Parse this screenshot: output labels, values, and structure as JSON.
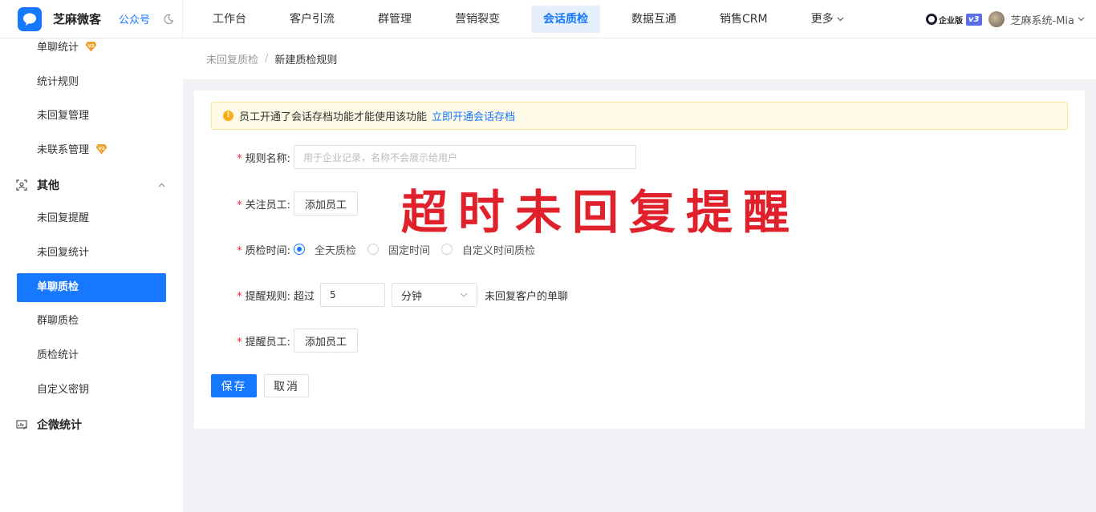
{
  "brand": {
    "name": "芝麻微客",
    "gzh": "公众号"
  },
  "nav": [
    "工作台",
    "客户引流",
    "群管理",
    "营销裂变",
    "会话质检",
    "数据互通",
    "销售CRM"
  ],
  "nav_active": "会话质检",
  "nav_more": "更多",
  "account": {
    "edition": "企业版",
    "version": "v3",
    "username": "芝麻系统-Mia"
  },
  "sidebar": {
    "item_1": "单聊统计",
    "item_2": "统计规则",
    "item_3": "未回复管理",
    "item_4": "未联系管理",
    "group_other": "其他",
    "item_5": "未回复提醒",
    "item_6": "未回复统计",
    "item_7": "单聊质检",
    "item_8": "群聊质检",
    "item_9": "质检统计",
    "item_10": "自定义密钥",
    "group_stats": "企微统计"
  },
  "breadcrumb": {
    "parent": "未回复质检",
    "sep": "/",
    "current": "新建质检规则"
  },
  "alert": {
    "text": "员工开通了会话存档功能才能使用该功能",
    "link": "立即开通会话存档"
  },
  "form": {
    "rule_name_label": "规则名称:",
    "rule_name_placeholder": "用于企业记录，名称不会展示给用户",
    "watch_staff_label": "关注员工:",
    "add_staff": "添加员工",
    "qc_time_label": "质检时间:",
    "opt_all_day": "全天质检",
    "opt_fixed": "固定时间",
    "opt_custom": "自定义时间质检",
    "remind_rule_label": "提醒规则:",
    "exceed": "超过",
    "minutes_value": "5",
    "unit": "分钟",
    "suffix": "未回复客户的单聊",
    "remind_staff_label": "提醒员工:",
    "save": "保存",
    "cancel": "取消"
  },
  "overlay_text": "超时未回复提醒",
  "colors": {
    "primary": "#1677ff",
    "overlay": "#e0202a",
    "alert_bg": "#fffbe6"
  }
}
